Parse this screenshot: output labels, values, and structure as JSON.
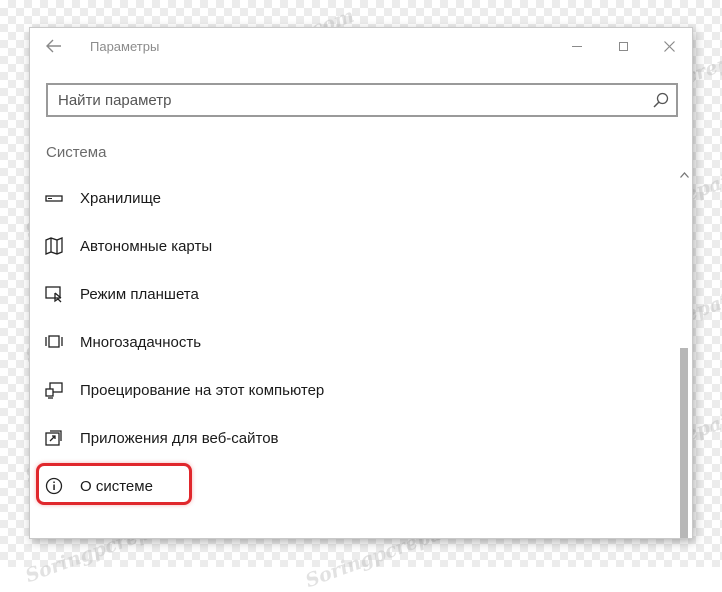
{
  "window": {
    "title": "Параметры",
    "back_icon": "arrow-left-icon",
    "minimize_icon": "minimize-icon",
    "maximize_icon": "maximize-icon",
    "close_icon": "close-icon"
  },
  "search": {
    "placeholder": "Найти параметр",
    "value": "",
    "icon": "search-icon"
  },
  "section": {
    "title": "Система"
  },
  "menu": {
    "items": [
      {
        "label": "Хранилище",
        "icon": "storage-drive-icon"
      },
      {
        "label": "Автономные карты",
        "icon": "map-icon"
      },
      {
        "label": "Режим планшета",
        "icon": "tablet-mode-icon"
      },
      {
        "label": "Многозадачность",
        "icon": "multitasking-icon"
      },
      {
        "label": "Проецирование на этот компьютер",
        "icon": "projecting-icon"
      },
      {
        "label": "Приложения для веб-сайтов",
        "icon": "apps-for-websites-icon"
      },
      {
        "label": "О системе",
        "icon": "info-icon"
      }
    ]
  },
  "highlight": {
    "color": "#e0272c",
    "target": "О системе"
  },
  "watermark": {
    "text": "Soringpcrepair.com"
  }
}
